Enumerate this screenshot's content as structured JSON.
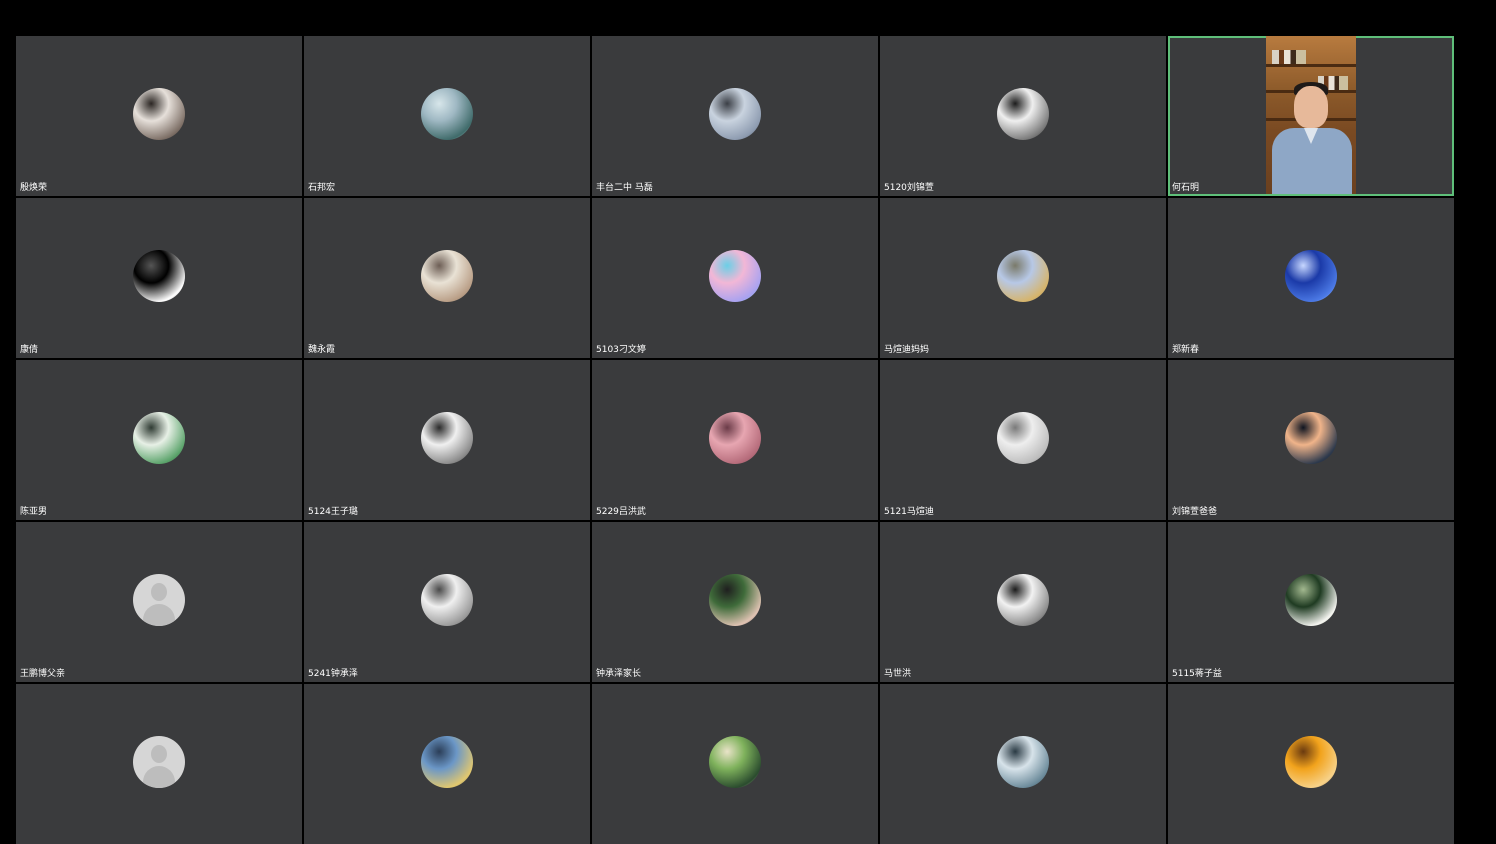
{
  "meeting": {
    "active_speaker_border_color": "#5fbf7a",
    "tile_background_color": "#3a3b3d"
  },
  "participants": [
    {
      "name": "殷焕荣",
      "avatar": {
        "type": "photo",
        "icon": "person-photo-avatar",
        "colors": [
          "#e6e0da",
          "#7d6f66",
          "#2b2623"
        ]
      }
    },
    {
      "name": "石邦宏",
      "avatar": {
        "type": "photo",
        "icon": "lake-mountain-avatar",
        "colors": [
          "#9fb8c3",
          "#3f6b6a",
          "#d7e6ea"
        ]
      }
    },
    {
      "name": "丰台二中 马磊",
      "avatar": {
        "type": "photo",
        "icon": "beach-people-avatar",
        "colors": [
          "#c9d3df",
          "#8d9bb0",
          "#3b3f46"
        ]
      }
    },
    {
      "name": "5120刘锦萱",
      "avatar": {
        "type": "photo",
        "icon": "bw-portrait-avatar",
        "colors": [
          "#efefef",
          "#7a7a7a",
          "#1c1c1c"
        ]
      }
    },
    {
      "name": "何石明",
      "avatar": {
        "type": "video",
        "icon": "live-video-feed"
      },
      "active": true
    },
    {
      "name": "康倩",
      "avatar": {
        "type": "photo",
        "icon": "sketch-portrait-avatar",
        "colors": [
          "#000000",
          "#ffffff",
          "#555555"
        ]
      }
    },
    {
      "name": "魏永霞",
      "avatar": {
        "type": "photo",
        "icon": "straw-hat-avatar",
        "colors": [
          "#e9e2d5",
          "#b99e86",
          "#6d5e55"
        ]
      }
    },
    {
      "name": "5103刁文婷",
      "avatar": {
        "type": "photo",
        "icon": "pastel-bird-avatar",
        "colors": [
          "#f2b7d6",
          "#a8a2f0",
          "#6bcfe6"
        ]
      }
    },
    {
      "name": "马煊迪妈妈",
      "avatar": {
        "type": "photo",
        "icon": "autumn-leaves-avatar",
        "colors": [
          "#b7c8e6",
          "#d6b46a",
          "#7a7a6a"
        ]
      }
    },
    {
      "name": "郑新春",
      "avatar": {
        "type": "photo",
        "icon": "starry-sky-avatar",
        "colors": [
          "#1b3aa8",
          "#4c7ae6",
          "#c7d7ff"
        ]
      }
    },
    {
      "name": "陈亚男",
      "avatar": {
        "type": "photo",
        "icon": "anime-girl-avatar",
        "colors": [
          "#e7f0e6",
          "#5aa36a",
          "#2f3b33"
        ]
      }
    },
    {
      "name": "5124王子璐",
      "avatar": {
        "type": "photo",
        "icon": "city-skyline-avatar",
        "colors": [
          "#f0f0f0",
          "#8b8b8b",
          "#2b2b2b"
        ]
      }
    },
    {
      "name": "5229吕洪武",
      "avatar": {
        "type": "photo",
        "icon": "sunset-avatar",
        "colors": [
          "#e7a6b1",
          "#b56b7a",
          "#6b3b48"
        ]
      }
    },
    {
      "name": "5121马煊迪",
      "avatar": {
        "type": "photo",
        "icon": "winter-tree-avatar",
        "colors": [
          "#eeeeee",
          "#bdbdbd",
          "#7a7a7a"
        ]
      }
    },
    {
      "name": "刘锦萱爸爸",
      "avatar": {
        "type": "photo",
        "icon": "silhouette-sunset-avatar",
        "colors": [
          "#f0b48a",
          "#2e3a4d",
          "#0f1420"
        ]
      }
    },
    {
      "name": "王鹏博父亲",
      "avatar": {
        "type": "default",
        "icon": "default-user-avatar"
      }
    },
    {
      "name": "5241钟承泽",
      "avatar": {
        "type": "photo",
        "icon": "bw-anime-avatar",
        "colors": [
          "#f0f0f0",
          "#9a9a9a",
          "#4a4a4a"
        ]
      }
    },
    {
      "name": "钟承泽家长",
      "avatar": {
        "type": "photo",
        "icon": "woman-portrait-avatar",
        "colors": [
          "#3f6b3a",
          "#e0c3b3",
          "#1f1f1f"
        ]
      }
    },
    {
      "name": "马世洪",
      "avatar": {
        "type": "photo",
        "icon": "ink-horse-avatar",
        "colors": [
          "#f2f2f2",
          "#8a8a8a",
          "#1c1c1c"
        ]
      }
    },
    {
      "name": "5115蒋子益",
      "avatar": {
        "type": "photo",
        "icon": "lotus-avatar",
        "colors": [
          "#1f3b22",
          "#f4f4f0",
          "#a2b88f"
        ]
      }
    },
    {
      "name": "",
      "avatar": {
        "type": "default",
        "icon": "default-user-avatar"
      }
    },
    {
      "name": "",
      "avatar": {
        "type": "photo",
        "icon": "bridge-water-avatar",
        "colors": [
          "#6b97c7",
          "#e2c86e",
          "#2b3e58"
        ]
      }
    },
    {
      "name": "",
      "avatar": {
        "type": "photo",
        "icon": "cartoon-animals-avatar",
        "colors": [
          "#7fb25c",
          "#2a4b2e",
          "#e9e3c8"
        ]
      }
    },
    {
      "name": "",
      "avatar": {
        "type": "photo",
        "icon": "anime-portrait-avatar",
        "colors": [
          "#d7e3ea",
          "#6b8a9a",
          "#2a3a44"
        ]
      }
    },
    {
      "name": "",
      "avatar": {
        "type": "photo",
        "icon": "garfield-cat-avatar",
        "colors": [
          "#f2a31c",
          "#f7d28a",
          "#6a3a10"
        ]
      }
    }
  ]
}
